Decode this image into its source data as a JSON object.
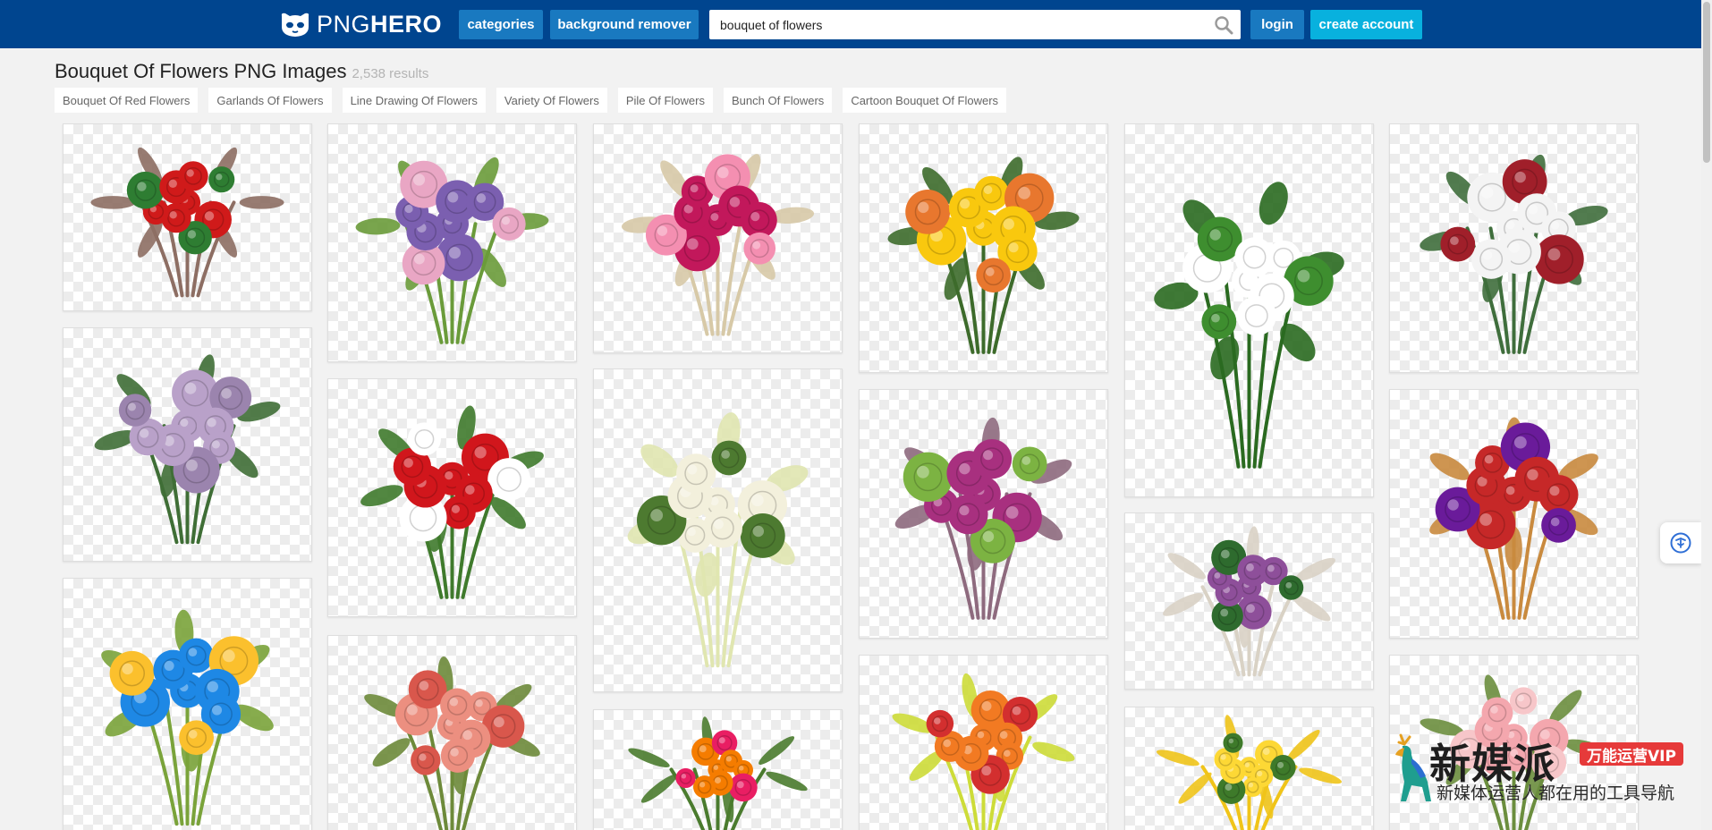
{
  "header": {
    "logo_light": "PNG",
    "logo_bold": "HERO",
    "categories_label": "categories",
    "bg_remover_label": "background remover",
    "search_value": "bouquet of flowers",
    "login_label": "login",
    "create_account_label": "create account",
    "bar_color": "#00458f",
    "button_color": "#1979c0",
    "cta_color": "#08b1de"
  },
  "results": {
    "title": "Bouquet Of Flowers PNG Images",
    "count": "2,538 results"
  },
  "tags": [
    "Bouquet Of Red Flowers",
    "Garlands Of Flowers",
    "Line Drawing Of Flowers",
    "Variety Of Flowers",
    "Pile Of Flowers",
    "Bunch Of Flowers",
    "Cartoon Bouquet Of Flowers"
  ],
  "images": [
    {
      "subject": "red anthurium arrangement with palm leaf",
      "palette": [
        "#d01a1a",
        "#2e7d32",
        "#8d6e63"
      ]
    },
    {
      "subject": "purple columbine bouquet",
      "palette": [
        "#7b5fb0",
        "#e9a6c4",
        "#6a9b3a"
      ]
    },
    {
      "subject": "pink carnation flower basket",
      "palette": [
        "#c2185b",
        "#f48fb1",
        "#d7c9a7"
      ]
    },
    {
      "subject": "sunflowers in terracotta pot",
      "palette": [
        "#f9c80e",
        "#e8772e",
        "#3d6b2b"
      ]
    },
    {
      "subject": "lily of the valley bouquet",
      "palette": [
        "#ffffff",
        "#3e8e2f",
        "#2a6a20"
      ]
    },
    {
      "subject": "white poinsettia christmas garland",
      "palette": [
        "#f4f4f4",
        "#a01f2a",
        "#3f6e3c"
      ]
    },
    {
      "subject": "lavender roses bouquet",
      "palette": [
        "#b9a1c9",
        "#9b84ae",
        "#3f6e36"
      ]
    },
    {
      "subject": "red roses and gypsophila arrangement",
      "palette": [
        "#d1161c",
        "#ffffff",
        "#3f7a2c"
      ]
    },
    {
      "subject": "white roses bouquet",
      "palette": [
        "#f3f0dc",
        "#4d7a30",
        "#e0e6b0"
      ]
    },
    {
      "subject": "purple tulips bouquet with ribbon",
      "palette": [
        "#a8307f",
        "#7cb342",
        "#8e6a7e"
      ]
    },
    {
      "subject": "mixed wildflower posy",
      "palette": [
        "#8e4f9a",
        "#2e6b2e",
        "#d9d2c5"
      ]
    },
    {
      "subject": "tulips in wicker basket",
      "palette": [
        "#c62828",
        "#6a1b9a",
        "#c98a3e"
      ]
    },
    {
      "subject": "blue and yellow spring flowers",
      "palette": [
        "#1e88e5",
        "#fbc02d",
        "#7aa33a"
      ]
    },
    {
      "subject": "vintage pink roses with card",
      "palette": [
        "#ec8f80",
        "#d9574c",
        "#6d8a3a"
      ]
    },
    {
      "subject": "colorful peony arrangement",
      "palette": [
        "#f57c00",
        "#e91e63",
        "#4a7b2e"
      ]
    },
    {
      "subject": "gerbera and chrysanthemum bouquet",
      "palette": [
        "#f27a22",
        "#d32f2f",
        "#cddc39"
      ]
    },
    {
      "subject": "yellow roses bouquet",
      "palette": [
        "#fdd835",
        "#3e7a2a",
        "#f0c419"
      ]
    },
    {
      "subject": "pink rose sprig",
      "palette": [
        "#f4a7ae",
        "#f7c6c9",
        "#6b8e3e"
      ]
    }
  ],
  "ad": {
    "title": "新媒派",
    "badge": "万能运营VIP",
    "subtitle": "新媒体运营人都在用的工具导航"
  }
}
